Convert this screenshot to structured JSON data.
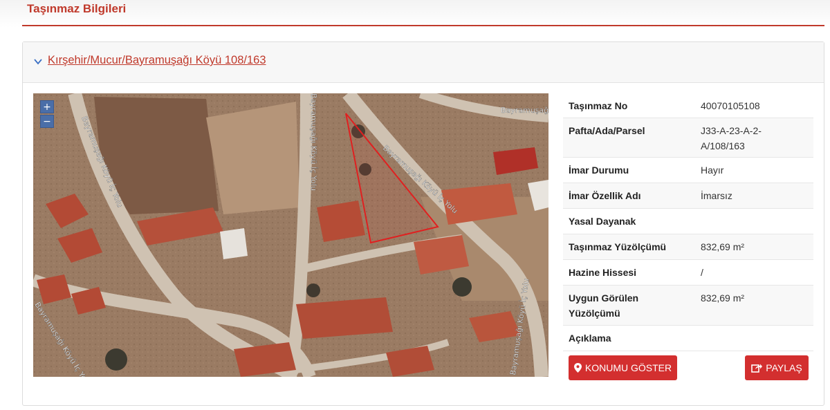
{
  "page": {
    "title": "Taşınmaz Bilgileri"
  },
  "card": {
    "title": "Kırşehir/Mucur/Bayramuşağı Köyü 108/163"
  },
  "map": {
    "zoom_in": "+",
    "zoom_out": "−",
    "road_labels": {
      "left": "Bayramuşağı Köyü İç Yolu",
      "center": "Bayramuşağı Köyü İç Yolu",
      "diagonal": "Bayramuşağı Köyü İç Yolu",
      "top_right": "Bayramuşağı",
      "bottom_right": "Bayramuşağı Köyü İç Yolu",
      "bottom_left": "Bayramuşağı Köyü İç Yo"
    },
    "parcel_outline_color": "#e02020"
  },
  "info": {
    "rows": [
      {
        "label": "Taşınmaz No",
        "value": "40070105108"
      },
      {
        "label": "Pafta/Ada/Parsel",
        "value": "J33-A-23-A-2-A/108/163"
      },
      {
        "label": "İmar Durumu",
        "value": "Hayır"
      },
      {
        "label": "İmar Özellik Adı",
        "value": "İmarsız"
      },
      {
        "label": "Yasal Dayanak",
        "value": ""
      },
      {
        "label": "Taşınmaz Yüzölçümü",
        "value": "832,69 m²"
      },
      {
        "label": "Hazine Hissesi",
        "value": "/"
      },
      {
        "label": "Uygun Görülen Yüzölçümü",
        "value": "832,69 m²"
      },
      {
        "label": "Açıklama",
        "value": ""
      }
    ]
  },
  "actions": {
    "show_location": "KONUMU GÖSTER",
    "share": "PAYLAŞ"
  },
  "colors": {
    "accent": "#c0392b",
    "button": "#d32f2f"
  }
}
